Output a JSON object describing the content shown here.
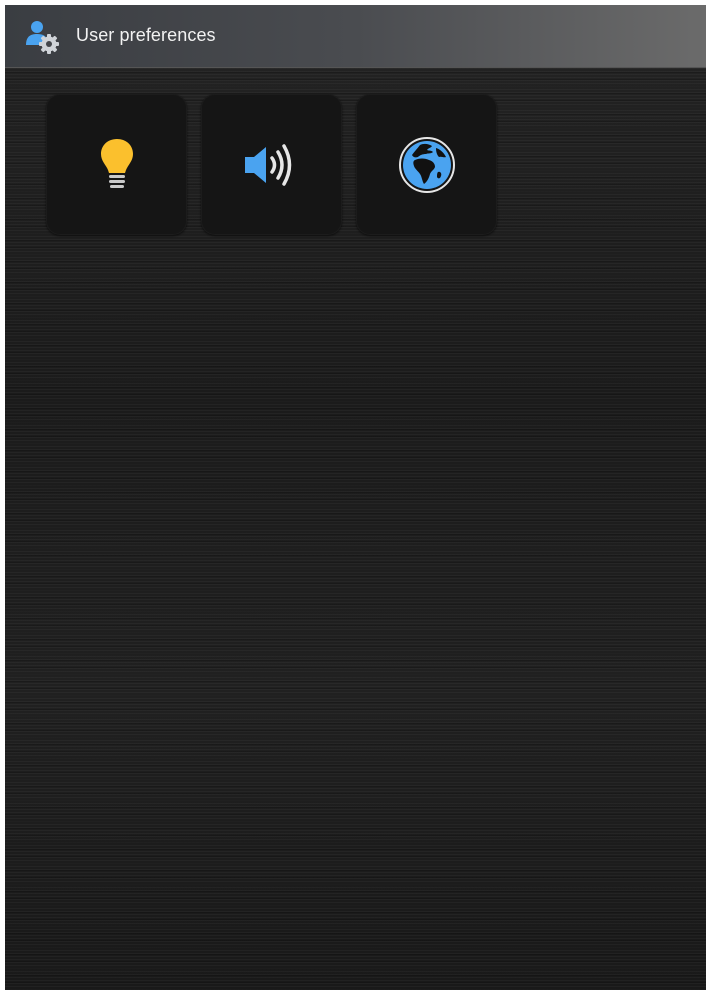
{
  "header": {
    "title": "User preferences",
    "icon": "user-settings-icon"
  },
  "tiles": [
    {
      "icon": "lightbulb-icon",
      "color": "#fbc02d"
    },
    {
      "icon": "speaker-volume-icon",
      "color": "#4aa3f0"
    },
    {
      "icon": "globe-icon",
      "color": "#4aa3f0"
    }
  ],
  "colors": {
    "accent": "#4aa3f0",
    "bulb": "#fbc02d",
    "background": "#1c1c1c"
  }
}
